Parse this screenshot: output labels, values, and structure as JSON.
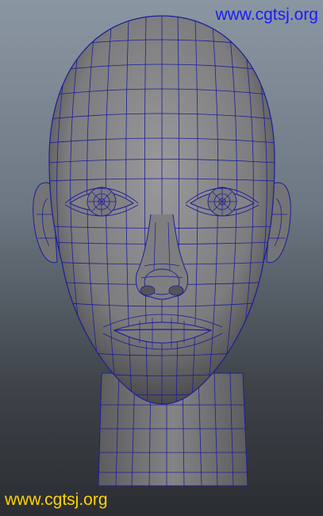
{
  "watermarks": {
    "top_text": "www.cgtsj.org",
    "top_color": "#1a1aff",
    "bottom_text": "www.cgtsj.org",
    "bottom_color": "#ffd400"
  },
  "viewport": {
    "background_top": "#8a96a2",
    "background_bottom": "#2a2d31",
    "mesh_fill": "#8a8a8c",
    "wire_color": "#1c1c9a",
    "model": "head-wireframe"
  }
}
